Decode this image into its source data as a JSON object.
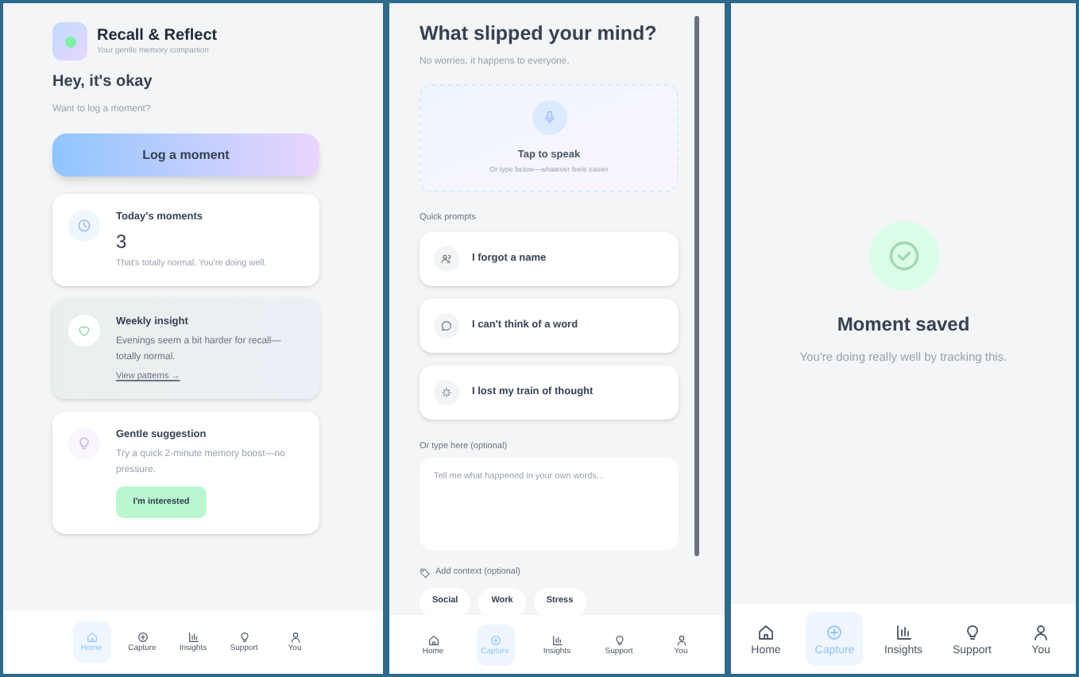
{
  "screens": [
    {
      "kind": "home",
      "app_title": "Recall & Reflect",
      "app_subtitle": "Your gentle memory companion",
      "greeting": "Hey, it's okay",
      "prompt": "Want to log a moment?",
      "primary_button": "Log a moment",
      "cards": [
        {
          "kind": "stat",
          "title": "Today's moments",
          "value": "3",
          "text": "That's totally normal. You're doing well."
        },
        {
          "kind": "insight",
          "title": "Weekly insight",
          "text": "Evenings seem a bit harder for recall—totally normal.",
          "link": "View patterns →"
        },
        {
          "kind": "suggestion",
          "title": "Gentle suggestion",
          "text": "Try a quick 2-minute memory boost—no pressure.",
          "button": "I'm interested"
        }
      ],
      "nav": [
        {
          "label": "Home",
          "selected": true
        },
        {
          "label": "Capture",
          "selected": false
        },
        {
          "label": "Insights",
          "selected": false
        },
        {
          "label": "Support",
          "selected": false
        },
        {
          "label": "You",
          "selected": false
        }
      ]
    },
    {
      "kind": "capture",
      "title": "What slipped your mind?",
      "subtitle": "No worries, it happens to everyone.",
      "voice": {
        "label": "Tap to speak",
        "hint": "Or type below—whatever feels easier"
      },
      "prompts_label": "Quick prompts",
      "prompts": [
        {
          "label": "I forgot a name"
        },
        {
          "label": "I can't think of a word"
        },
        {
          "label": "I lost my train of thought"
        }
      ],
      "text_label": "Or type here (optional)",
      "text_placeholder": "Tell me what happened in your own words...",
      "context_label": "Add context (optional)",
      "tags": [
        "Social",
        "Work",
        "Stress"
      ],
      "nav": [
        {
          "label": "Home",
          "selected": false
        },
        {
          "label": "Capture",
          "selected": true
        },
        {
          "label": "Insights",
          "selected": false
        },
        {
          "label": "Support",
          "selected": false
        },
        {
          "label": "You",
          "selected": false
        }
      ]
    },
    {
      "kind": "saved",
      "title": "Moment saved",
      "text": "You're doing really well by tracking this.",
      "nav": [
        {
          "label": "Home",
          "selected": false
        },
        {
          "label": "Capture",
          "selected": true
        },
        {
          "label": "Insights",
          "selected": false
        },
        {
          "label": "Support",
          "selected": false
        },
        {
          "label": "You",
          "selected": false
        }
      ]
    }
  ]
}
